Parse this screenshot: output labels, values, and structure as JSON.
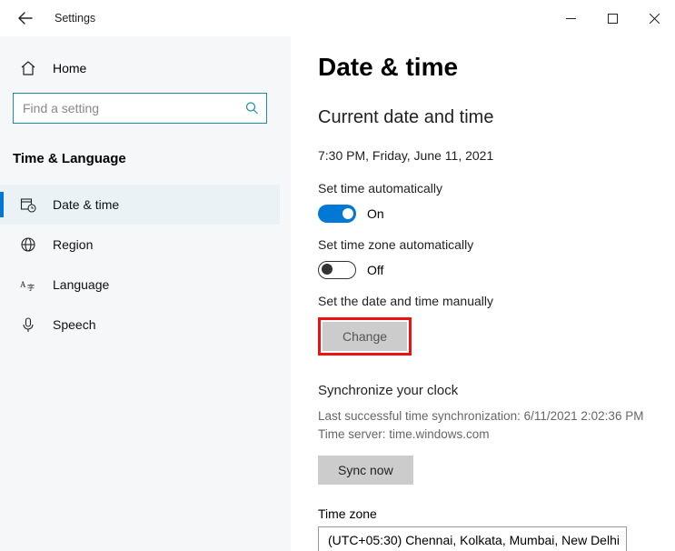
{
  "window": {
    "title": "Settings"
  },
  "sidebar": {
    "home": "Home",
    "search_placeholder": "Find a setting",
    "group_title": "Time & Language",
    "items": [
      {
        "label": "Date & time"
      },
      {
        "label": "Region"
      },
      {
        "label": "Language"
      },
      {
        "label": "Speech"
      }
    ]
  },
  "main": {
    "heading": "Date & time",
    "subheading": "Current date and time",
    "current_datetime": "7:30 PM, Friday, June 11, 2021",
    "set_time_auto_label": "Set time automatically",
    "set_time_auto_state": "On",
    "set_tz_auto_label": "Set time zone automatically",
    "set_tz_auto_state": "Off",
    "set_manual_label": "Set the date and time manually",
    "change_button": "Change",
    "sync_heading": "Synchronize your clock",
    "sync_last": "Last successful time synchronization: 6/11/2021 2:02:36 PM",
    "sync_server": "Time server: time.windows.com",
    "sync_button": "Sync now",
    "tz_label": "Time zone",
    "tz_value": "(UTC+05:30) Chennai, Kolkata, Mumbai, New Delhi"
  }
}
